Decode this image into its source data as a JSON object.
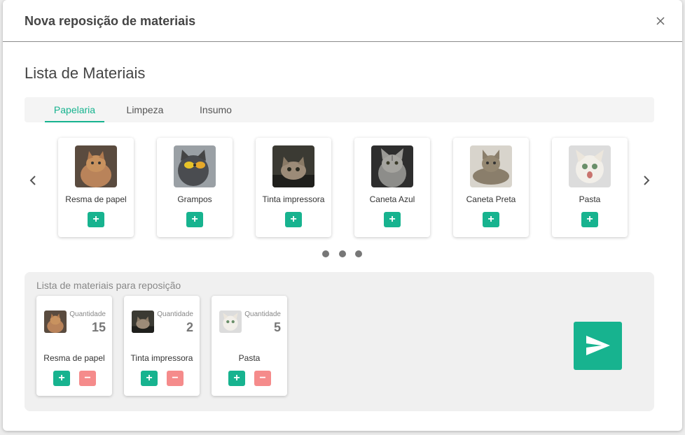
{
  "modal": {
    "title": "Nova reposição de materiais",
    "close_icon": "close-icon"
  },
  "section_title": "Lista de Materiais",
  "tabs": [
    {
      "label": "Papelaria",
      "active": true
    },
    {
      "label": "Limpeza",
      "active": false
    },
    {
      "label": "Insumo",
      "active": false
    }
  ],
  "carousel": {
    "prev_icon": "chevron-left-icon",
    "next_icon": "chevron-right-icon",
    "items": [
      {
        "name": "Resma de papel",
        "add_label": "+",
        "image": "cat-photo"
      },
      {
        "name": "Grampos",
        "add_label": "+",
        "image": "cat-photo"
      },
      {
        "name": "Tinta impressora",
        "add_label": "+",
        "image": "cat-photo"
      },
      {
        "name": "Caneta Azul",
        "add_label": "+",
        "image": "cat-photo"
      },
      {
        "name": "Caneta Preta",
        "add_label": "+",
        "image": "cat-photo"
      },
      {
        "name": "Pasta",
        "add_label": "+",
        "image": "cat-photo"
      }
    ],
    "pages": 3
  },
  "reposicao": {
    "title": "Lista de materiais para reposição",
    "quantity_label": "Quantidade",
    "items": [
      {
        "name": "Resma de papel",
        "quantity": "15",
        "add_label": "+",
        "remove_label": "−"
      },
      {
        "name": "Tinta impressora",
        "quantity": "2",
        "add_label": "+",
        "remove_label": "−"
      },
      {
        "name": "Pasta",
        "quantity": "5",
        "add_label": "+",
        "remove_label": "−"
      }
    ],
    "send_icon": "send-icon"
  },
  "colors": {
    "accent": "#17b38f",
    "danger": "#f58b8b"
  }
}
